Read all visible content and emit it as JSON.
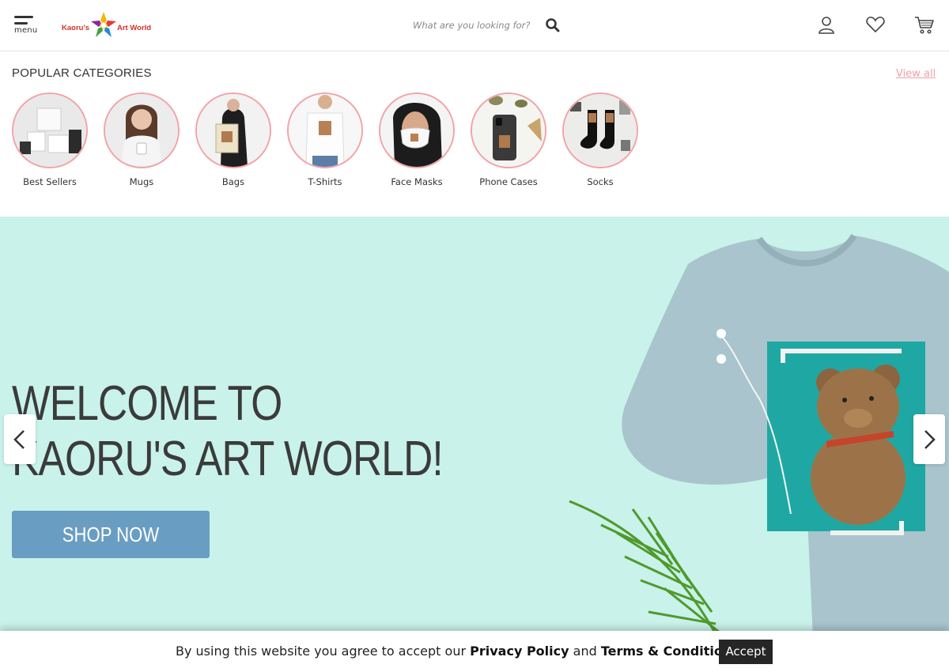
{
  "header": {
    "menu_label": "menu",
    "logo_text_left": "Kaoru's",
    "logo_text_right": "Art World",
    "search_placeholder": "What are you looking for?"
  },
  "categories": {
    "title": "POPULAR CATEGORIES",
    "view_all": "View all",
    "items": [
      {
        "label": "Best Sellers"
      },
      {
        "label": "Mugs"
      },
      {
        "label": "Bags"
      },
      {
        "label": "T-Shirts"
      },
      {
        "label": "Face Masks"
      },
      {
        "label": "Phone Cases"
      },
      {
        "label": "Socks"
      }
    ]
  },
  "hero": {
    "title_line1": "WELCOME TO",
    "title_line2": "KAORU'S ART WORLD!",
    "cta": "SHOP NOW"
  },
  "cookie": {
    "prefix": "By using this website you agree to accept our ",
    "privacy": "Privacy Policy",
    "and": " and ",
    "terms": "Terms & Conditions",
    "accept": "Accept"
  },
  "colors": {
    "accent_pink": "#f2a3a8",
    "hero_bg": "#c9f2ea",
    "button_blue": "#6a9dc2",
    "accept_bg": "#262626"
  },
  "icons": [
    "menu-icon",
    "search-icon",
    "user-icon",
    "heart-icon",
    "cart-icon",
    "chevron-left-icon",
    "chevron-right-icon"
  ]
}
